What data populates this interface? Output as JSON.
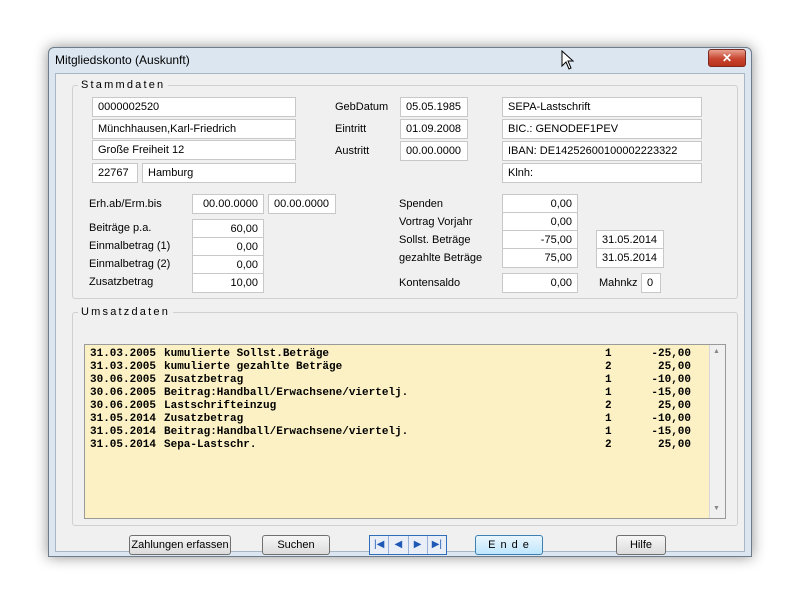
{
  "window": {
    "title": "Mitgliedskonto  (Auskunft)",
    "close": "✕"
  },
  "stamm": {
    "legend": "Stammdaten",
    "mitglied_nr": "0000002520",
    "name": "Münchhausen,Karl-Friedrich",
    "strasse": "Große Freiheit 12",
    "plz": "22767",
    "ort": "Hamburg",
    "gebdatum_label": "GebDatum",
    "gebdatum": "05.05.1985",
    "eintritt_label": "Eintritt",
    "eintritt": "01.09.2008",
    "austritt_label": "Austritt",
    "austritt": "00.00.0000",
    "zahlungsart": "SEPA-Lastschrift",
    "bic": "BIC.: GENODEF1PEV",
    "iban": "IBAN: DE14252600100002223322",
    "kinh": "Klnh:",
    "erh_label": "Erh.ab/Erm.bis",
    "erh_ab": "00.00.0000",
    "erm_bis": "00.00.0000",
    "beitraege_label": "Beiträge p.a.",
    "beitraege": "60,00",
    "einmal1_label": "Einmalbetrag (1)",
    "einmal1": "0,00",
    "einmal2_label": "Einmalbetrag (2)",
    "einmal2": "0,00",
    "zusatz_label": "Zusatzbetrag",
    "zusatz": "10,00",
    "spenden_label": "Spenden",
    "spenden": "0,00",
    "vortrag_label": "Vortrag Vorjahr",
    "vortrag": "0,00",
    "sollst_label": "Sollst. Beträge",
    "sollst": "-75,00",
    "sollst_date": "31.05.2014",
    "gezahlt_label": "gezahlte Beträge",
    "gezahlt": "75,00",
    "gezahlt_date": "31.05.2014",
    "saldo_label": "Kontensaldo",
    "saldo": "0,00",
    "mahnkz_label": "Mahnkz",
    "mahnkz": "0"
  },
  "umsatz": {
    "legend": "Umsatzdaten",
    "rows": [
      {
        "date": "31.03.2005",
        "text": "kumulierte Sollst.Beträge",
        "code": "1",
        "amount": "-25,00"
      },
      {
        "date": "31.03.2005",
        "text": "kumulierte gezahlte Beträge",
        "code": "2",
        "amount": "25,00"
      },
      {
        "date": "30.06.2005",
        "text": "Zusatzbetrag",
        "code": "1",
        "amount": "-10,00"
      },
      {
        "date": "30.06.2005",
        "text": "Beitrag:Handball/Erwachsene/viertelj.",
        "code": "1",
        "amount": "-15,00"
      },
      {
        "date": "30.06.2005",
        "text": "Lastschrifteinzug",
        "code": "2",
        "amount": "25,00"
      },
      {
        "date": "31.05.2014",
        "text": "Zusatzbetrag",
        "code": "1",
        "amount": "-10,00"
      },
      {
        "date": "31.05.2014",
        "text": "Beitrag:Handball/Erwachsene/viertelj.",
        "code": "1",
        "amount": "-15,00"
      },
      {
        "date": "31.05.2014",
        "text": "Sepa-Lastschr.",
        "code": "2",
        "amount": "25,00"
      }
    ]
  },
  "buttons": {
    "zahlungen": "Zahlungen erfassen",
    "suchen": "Suchen",
    "ende": "E n d e",
    "hilfe": "Hilfe",
    "nav_first": "|◀",
    "nav_prev": "◀",
    "nav_next": "▶",
    "nav_last": "▶|"
  },
  "scroll": {
    "up": "▲",
    "down": "▼"
  },
  "colors": {
    "list_bg": "#fbf1c4",
    "window_bg": "#dbe6f1",
    "close_red": "#c8452f"
  }
}
